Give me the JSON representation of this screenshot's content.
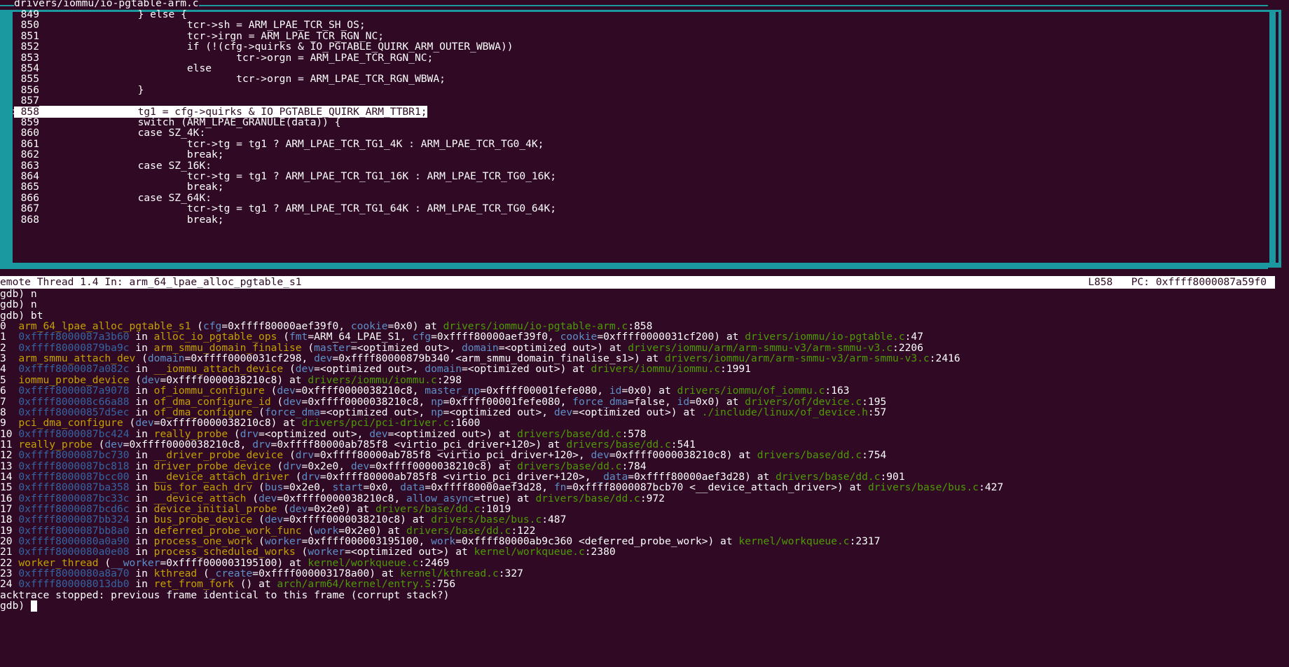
{
  "source": {
    "title": "drivers/iommu/io-pgtable-arm.c",
    "current_marker": ">",
    "lines": [
      {
        "num": "849",
        "code": "                } else {"
      },
      {
        "num": "850",
        "code": "                        tcr->sh = ARM_LPAE_TCR_SH_OS;"
      },
      {
        "num": "851",
        "code": "                        tcr->irgn = ARM_LPAE_TCR_RGN_NC;"
      },
      {
        "num": "852",
        "code": "                        if (!(cfg->quirks & IO_PGTABLE_QUIRK_ARM_OUTER_WBWA))"
      },
      {
        "num": "853",
        "code": "                                tcr->orgn = ARM_LPAE_TCR_RGN_NC;"
      },
      {
        "num": "854",
        "code": "                        else"
      },
      {
        "num": "855",
        "code": "                                tcr->orgn = ARM_LPAE_TCR_RGN_WBWA;"
      },
      {
        "num": "856",
        "code": "                }"
      },
      {
        "num": "857",
        "code": ""
      },
      {
        "num": "858",
        "code": "                tg1 = cfg->quirks & IO_PGTABLE_QUIRK_ARM_TTBR1;"
      },
      {
        "num": "859",
        "code": "                switch (ARM_LPAE_GRANULE(data)) {"
      },
      {
        "num": "860",
        "code": "                case SZ_4K:"
      },
      {
        "num": "861",
        "code": "                        tcr->tg = tg1 ? ARM_LPAE_TCR_TG1_4K : ARM_LPAE_TCR_TG0_4K;"
      },
      {
        "num": "862",
        "code": "                        break;"
      },
      {
        "num": "863",
        "code": "                case SZ_16K:"
      },
      {
        "num": "864",
        "code": "                        tcr->tg = tg1 ? ARM_LPAE_TCR_TG1_16K : ARM_LPAE_TCR_TG0_16K;"
      },
      {
        "num": "865",
        "code": "                        break;"
      },
      {
        "num": "866",
        "code": "                case SZ_64K:"
      },
      {
        "num": "867",
        "code": "                        tcr->tg = tg1 ? ARM_LPAE_TCR_TG1_64K : ARM_LPAE_TCR_TG0_64K;"
      },
      {
        "num": "868",
        "code": "                        break;"
      }
    ]
  },
  "status": {
    "left": "emote Thread 1.4 In: arm_64_lpae_alloc_pgtable_s1",
    "right": "L858   PC: 0xffff8000087a59f0"
  },
  "console": {
    "commands": [
      "gdb) n",
      "gdb) n",
      "gdb) bt"
    ],
    "frames": [
      [
        [
          "0  ",
          "t"
        ],
        [
          "arm_64_lpae_alloc_pgtable_s1",
          "f"
        ],
        [
          " (",
          "t"
        ],
        [
          "cfg",
          "a"
        ],
        [
          "=0xffff80000aef39f0, ",
          "t"
        ],
        [
          "cookie",
          "a"
        ],
        [
          "=0x0) at ",
          "t"
        ],
        [
          "drivers/iommu/io-pgtable-arm.c",
          "p"
        ],
        [
          ":858",
          "t"
        ]
      ],
      [
        [
          "1  ",
          "t"
        ],
        [
          "0xffff8000087a3b60",
          "d"
        ],
        [
          " in ",
          "t"
        ],
        [
          "alloc_io_pgtable_ops",
          "f"
        ],
        [
          " (",
          "t"
        ],
        [
          "fmt",
          "a"
        ],
        [
          "=ARM_64_LPAE_S1, ",
          "t"
        ],
        [
          "cfg",
          "a"
        ],
        [
          "=0xffff80000aef39f0, ",
          "t"
        ],
        [
          "cookie",
          "a"
        ],
        [
          "=0xffff0000031cf200) at ",
          "t"
        ],
        [
          "drivers/iommu/io-pgtable.c",
          "p"
        ],
        [
          ":47",
          "t"
        ]
      ],
      [
        [
          "2  ",
          "t"
        ],
        [
          "0xffff80000879ba9c",
          "d"
        ],
        [
          " in ",
          "t"
        ],
        [
          "arm_smmu_domain_finalise",
          "f"
        ],
        [
          " (",
          "t"
        ],
        [
          "master",
          "a"
        ],
        [
          "=<optimized out>, ",
          "t"
        ],
        [
          "domain",
          "a"
        ],
        [
          "=<optimized out>) at ",
          "t"
        ],
        [
          "drivers/iommu/arm/arm-smmu-v3/arm-smmu-v3.c",
          "p"
        ],
        [
          ":2206",
          "t"
        ]
      ],
      [
        [
          "3  ",
          "t"
        ],
        [
          "arm_smmu_attach_dev",
          "f"
        ],
        [
          " (",
          "t"
        ],
        [
          "domain",
          "a"
        ],
        [
          "=0xffff0000031cf298, ",
          "t"
        ],
        [
          "dev",
          "a"
        ],
        [
          "=0xffff80000879b340 <arm_smmu_domain_finalise_s1>) at ",
          "t"
        ],
        [
          "drivers/iommu/arm/arm-smmu-v3/arm-smmu-v3.c",
          "p"
        ],
        [
          ":2416",
          "t"
        ]
      ],
      [
        [
          "4  ",
          "t"
        ],
        [
          "0xffff8000087a082c",
          "d"
        ],
        [
          " in ",
          "t"
        ],
        [
          "__iommu_attach_device",
          "f"
        ],
        [
          " (",
          "t"
        ],
        [
          "dev",
          "a"
        ],
        [
          "=<optimized out>, ",
          "t"
        ],
        [
          "domain",
          "a"
        ],
        [
          "=<optimized out>) at ",
          "t"
        ],
        [
          "drivers/iommu/iommu.c",
          "p"
        ],
        [
          ":1991",
          "t"
        ]
      ],
      [
        [
          "5  ",
          "t"
        ],
        [
          "iommu_probe_device",
          "f"
        ],
        [
          " (",
          "t"
        ],
        [
          "dev",
          "a"
        ],
        [
          "=0xffff0000038210c8) at ",
          "t"
        ],
        [
          "drivers/iommu/iommu.c",
          "p"
        ],
        [
          ":298",
          "t"
        ]
      ],
      [
        [
          "6  ",
          "t"
        ],
        [
          "0xffff8000087a9078",
          "d"
        ],
        [
          " in ",
          "t"
        ],
        [
          "of_iommu_configure",
          "f"
        ],
        [
          " (",
          "t"
        ],
        [
          "dev",
          "a"
        ],
        [
          "=0xffff0000038210c8, ",
          "t"
        ],
        [
          "master_np",
          "a"
        ],
        [
          "=0xffff00001fefe080, ",
          "t"
        ],
        [
          "id",
          "a"
        ],
        [
          "=0x0) at ",
          "t"
        ],
        [
          "drivers/iommu/of_iommu.c",
          "p"
        ],
        [
          ":163",
          "t"
        ]
      ],
      [
        [
          "7  ",
          "t"
        ],
        [
          "0xffff800008c66a88",
          "d"
        ],
        [
          " in ",
          "t"
        ],
        [
          "of_dma_configure_id",
          "f"
        ],
        [
          " (",
          "t"
        ],
        [
          "dev",
          "a"
        ],
        [
          "=0xffff0000038210c8, ",
          "t"
        ],
        [
          "np",
          "a"
        ],
        [
          "=0xffff00001fefe080, ",
          "t"
        ],
        [
          "force_dma",
          "a"
        ],
        [
          "=false, ",
          "t"
        ],
        [
          "id",
          "a"
        ],
        [
          "=0x0) at ",
          "t"
        ],
        [
          "drivers/of/device.c",
          "p"
        ],
        [
          ":195",
          "t"
        ]
      ],
      [
        [
          "8  ",
          "t"
        ],
        [
          "0xffff80000857d5ec",
          "d"
        ],
        [
          " in ",
          "t"
        ],
        [
          "of_dma_configure",
          "f"
        ],
        [
          " (",
          "t"
        ],
        [
          "force_dma",
          "a"
        ],
        [
          "=<optimized out>, ",
          "t"
        ],
        [
          "np",
          "a"
        ],
        [
          "=<optimized out>, ",
          "t"
        ],
        [
          "dev",
          "a"
        ],
        [
          "=<optimized out>) at ",
          "t"
        ],
        [
          "./include/linux/of_device.h",
          "p"
        ],
        [
          ":57",
          "t"
        ]
      ],
      [
        [
          "9  ",
          "t"
        ],
        [
          "pci_dma_configure",
          "f"
        ],
        [
          " (",
          "t"
        ],
        [
          "dev",
          "a"
        ],
        [
          "=0xffff0000038210c8) at ",
          "t"
        ],
        [
          "drivers/pci/pci-driver.c",
          "p"
        ],
        [
          ":1600",
          "t"
        ]
      ],
      [
        [
          "10 ",
          "t"
        ],
        [
          "0xffff8000087bc424",
          "d"
        ],
        [
          " in ",
          "t"
        ],
        [
          "really_probe",
          "f"
        ],
        [
          " (",
          "t"
        ],
        [
          "drv",
          "a"
        ],
        [
          "=<optimized out>, ",
          "t"
        ],
        [
          "dev",
          "a"
        ],
        [
          "=<optimized out>) at ",
          "t"
        ],
        [
          "drivers/base/dd.c",
          "p"
        ],
        [
          ":578",
          "t"
        ]
      ],
      [
        [
          "11 ",
          "t"
        ],
        [
          "really_probe",
          "f"
        ],
        [
          " (",
          "t"
        ],
        [
          "dev",
          "a"
        ],
        [
          "=0xffff0000038210c8, ",
          "t"
        ],
        [
          "drv",
          "a"
        ],
        [
          "=0xffff80000ab785f8 <virtio_pci_driver+120>) at ",
          "t"
        ],
        [
          "drivers/base/dd.c",
          "p"
        ],
        [
          ":541",
          "t"
        ]
      ],
      [
        [
          "12 ",
          "t"
        ],
        [
          "0xffff8000087bc730",
          "d"
        ],
        [
          " in ",
          "t"
        ],
        [
          "__driver_probe_device",
          "f"
        ],
        [
          " (",
          "t"
        ],
        [
          "drv",
          "a"
        ],
        [
          "=0xffff80000ab785f8 <virtio_pci_driver+120>, ",
          "t"
        ],
        [
          "dev",
          "a"
        ],
        [
          "=0xffff0000038210c8) at ",
          "t"
        ],
        [
          "drivers/base/dd.c",
          "p"
        ],
        [
          ":754",
          "t"
        ]
      ],
      [
        [
          "13 ",
          "t"
        ],
        [
          "0xffff8000087bc818",
          "d"
        ],
        [
          " in ",
          "t"
        ],
        [
          "driver_probe_device",
          "f"
        ],
        [
          " (",
          "t"
        ],
        [
          "drv",
          "a"
        ],
        [
          "=0x2e0, ",
          "t"
        ],
        [
          "dev",
          "a"
        ],
        [
          "=0xffff0000038210c8) at ",
          "t"
        ],
        [
          "drivers/base/dd.c",
          "p"
        ],
        [
          ":784",
          "t"
        ]
      ],
      [
        [
          "14 ",
          "t"
        ],
        [
          "0xffff8000087bcc00",
          "d"
        ],
        [
          " in ",
          "t"
        ],
        [
          "__device_attach_driver",
          "f"
        ],
        [
          " (",
          "t"
        ],
        [
          "drv",
          "a"
        ],
        [
          "=0xffff80000ab785f8 <virtio_pci_driver+120>, ",
          "t"
        ],
        [
          "_data",
          "a"
        ],
        [
          "=0xffff80000aef3d28) at ",
          "t"
        ],
        [
          "drivers/base/dd.c",
          "p"
        ],
        [
          ":901",
          "t"
        ]
      ],
      [
        [
          "15 ",
          "t"
        ],
        [
          "0xffff8000087ba358",
          "d"
        ],
        [
          " in ",
          "t"
        ],
        [
          "bus_for_each_drv",
          "f"
        ],
        [
          " (",
          "t"
        ],
        [
          "bus",
          "a"
        ],
        [
          "=0x2e0, ",
          "t"
        ],
        [
          "start",
          "a"
        ],
        [
          "=0x0, ",
          "t"
        ],
        [
          "data",
          "a"
        ],
        [
          "=0xffff80000aef3d28, ",
          "t"
        ],
        [
          "fn",
          "a"
        ],
        [
          "=0xffff8000087bcb70 <__device_attach_driver>) at ",
          "t"
        ],
        [
          "drivers/base/bus.c",
          "p"
        ],
        [
          ":427",
          "t"
        ]
      ],
      [
        [
          "16 ",
          "t"
        ],
        [
          "0xffff8000087bc33c",
          "d"
        ],
        [
          " in ",
          "t"
        ],
        [
          "__device_attach",
          "f"
        ],
        [
          " (",
          "t"
        ],
        [
          "dev",
          "a"
        ],
        [
          "=0xffff0000038210c8, ",
          "t"
        ],
        [
          "allow_async",
          "a"
        ],
        [
          "=true) at ",
          "t"
        ],
        [
          "drivers/base/dd.c",
          "p"
        ],
        [
          ":972",
          "t"
        ]
      ],
      [
        [
          "17 ",
          "t"
        ],
        [
          "0xffff8000087bcd6c",
          "d"
        ],
        [
          " in ",
          "t"
        ],
        [
          "device_initial_probe",
          "f"
        ],
        [
          " (",
          "t"
        ],
        [
          "dev",
          "a"
        ],
        [
          "=0x2e0) at ",
          "t"
        ],
        [
          "drivers/base/dd.c",
          "p"
        ],
        [
          ":1019",
          "t"
        ]
      ],
      [
        [
          "18 ",
          "t"
        ],
        [
          "0xffff8000087bb324",
          "d"
        ],
        [
          " in ",
          "t"
        ],
        [
          "bus_probe_device",
          "f"
        ],
        [
          " (",
          "t"
        ],
        [
          "dev",
          "a"
        ],
        [
          "=0xffff0000038210c8) at ",
          "t"
        ],
        [
          "drivers/base/bus.c",
          "p"
        ],
        [
          ":487",
          "t"
        ]
      ],
      [
        [
          "19 ",
          "t"
        ],
        [
          "0xffff8000087bb8a0",
          "d"
        ],
        [
          " in ",
          "t"
        ],
        [
          "deferred_probe_work_func",
          "f"
        ],
        [
          " (",
          "t"
        ],
        [
          "work",
          "a"
        ],
        [
          "=0x2e0) at ",
          "t"
        ],
        [
          "drivers/base/dd.c",
          "p"
        ],
        [
          ":122",
          "t"
        ]
      ],
      [
        [
          "20 ",
          "t"
        ],
        [
          "0xffff8000080a0a90",
          "d"
        ],
        [
          " in ",
          "t"
        ],
        [
          "process_one_work",
          "f"
        ],
        [
          " (",
          "t"
        ],
        [
          "worker",
          "a"
        ],
        [
          "=0xffff000003195100, ",
          "t"
        ],
        [
          "work",
          "a"
        ],
        [
          "=0xffff80000ab9c360 <deferred_probe_work>) at ",
          "t"
        ],
        [
          "kernel/workqueue.c",
          "p"
        ],
        [
          ":2317",
          "t"
        ]
      ],
      [
        [
          "21 ",
          "t"
        ],
        [
          "0xffff8000080a0e08",
          "d"
        ],
        [
          " in ",
          "t"
        ],
        [
          "process_scheduled_works",
          "f"
        ],
        [
          " (",
          "t"
        ],
        [
          "worker",
          "a"
        ],
        [
          "=<optimized out>) at ",
          "t"
        ],
        [
          "kernel/workqueue.c",
          "p"
        ],
        [
          ":2380",
          "t"
        ]
      ],
      [
        [
          "22 ",
          "t"
        ],
        [
          "worker_thread",
          "f"
        ],
        [
          " (",
          "t"
        ],
        [
          "__worker",
          "a"
        ],
        [
          "=0xffff000003195100) at ",
          "t"
        ],
        [
          "kernel/workqueue.c",
          "p"
        ],
        [
          ":2469",
          "t"
        ]
      ],
      [
        [
          "23 ",
          "t"
        ],
        [
          "0xffff8000080a8a70",
          "d"
        ],
        [
          " in ",
          "t"
        ],
        [
          "kthread",
          "f"
        ],
        [
          " (",
          "t"
        ],
        [
          "_create",
          "a"
        ],
        [
          "=0xffff000003178a00) at ",
          "t"
        ],
        [
          "kernel/kthread.c",
          "p"
        ],
        [
          ":327",
          "t"
        ]
      ],
      [
        [
          "24 ",
          "t"
        ],
        [
          "0xffff800008013db0",
          "d"
        ],
        [
          " in ",
          "t"
        ],
        [
          "ret_from_fork",
          "f"
        ],
        [
          " () at ",
          "t"
        ],
        [
          "arch/arm64/kernel/entry.S",
          "p"
        ],
        [
          ":756",
          "t"
        ]
      ]
    ],
    "footer": "acktrace stopped: previous frame identical to this frame (corrupt stack?)",
    "prompt": "gdb) "
  }
}
